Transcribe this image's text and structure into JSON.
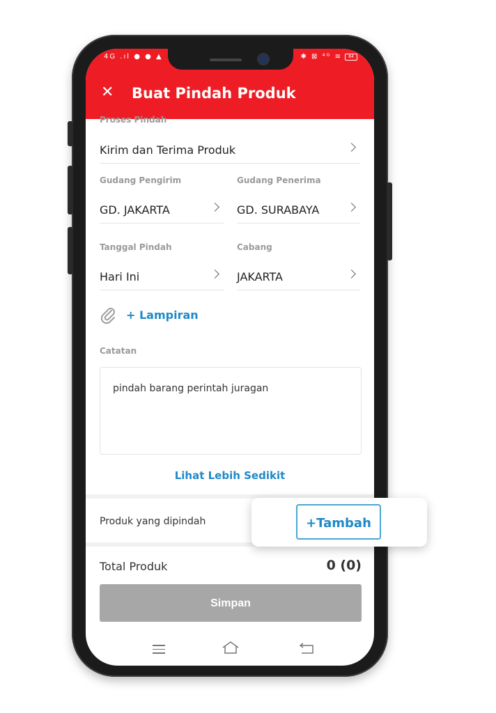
{
  "status_bar": {
    "left": "4G .ıl ● ● ▲",
    "right": "✱ ⊠ ⁴ᴳ ≋",
    "battery": "84"
  },
  "header": {
    "close_icon": "close-icon",
    "title": "Buat Pindah Produk"
  },
  "form": {
    "proses_label": "Proses Pindah",
    "proses_value": "Kirim dan Terima Produk",
    "gudang_pengirim_label": "Gudang Pengirim",
    "gudang_pengirim_value": "GD. JAKARTA",
    "gudang_penerima_label": "Gudang Penerima",
    "gudang_penerima_value": "GD. SURABAYA",
    "tanggal_label": "Tanggal Pindah",
    "tanggal_value": "Hari Ini",
    "cabang_label": "Cabang",
    "cabang_value": "JAKARTA",
    "lampiran_label": "+ Lampiran",
    "catatan_label": "Catatan",
    "catatan_value": "pindah barang perintah juragan",
    "toggle_label": "Lihat Lebih Sedikit"
  },
  "produk": {
    "label": "Produk yang dipindah",
    "add_label": "+Tambah"
  },
  "summary": {
    "total_label": "Total Produk",
    "total_value": "0 (0)",
    "save_label": "Simpan"
  },
  "colors": {
    "brand": "#ee1c24",
    "link": "#1e88c8",
    "disabled": "#a7a7a7"
  }
}
